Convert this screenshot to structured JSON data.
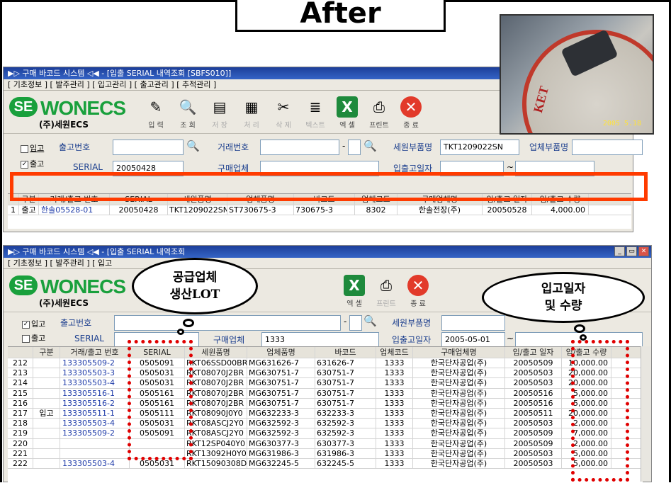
{
  "after_label": "After",
  "photo": {
    "ket_text": "KET",
    "timestamp": "2005 5.18"
  },
  "win1": {
    "title": "▶▷ 구매 바코드 시스템 ◁◀ - [입출 SERIAL 내역조회 [SBFS010]]",
    "menu": "[ 기초정보 ]  [ 발주관리 ]  [ 입고관리 ]  [ 출고관리 ]  [ 추적관리 ]",
    "logo": {
      "se": "SE",
      "name": "WONECS",
      "sub": "(주)세원ECS"
    },
    "toolbar": [
      {
        "icon": "eraser-icon",
        "glyph": "✎",
        "label": "입 력",
        "enabled": true
      },
      {
        "icon": "magnifier-icon",
        "glyph": "🔍",
        "label": "조 회",
        "enabled": true
      },
      {
        "icon": "floppy-icon",
        "glyph": "▤",
        "label": "저 장",
        "enabled": false
      },
      {
        "icon": "process-icon",
        "glyph": "▦",
        "label": "처 리",
        "enabled": false
      },
      {
        "icon": "delete-icon",
        "glyph": "✂",
        "label": "삭 제",
        "enabled": false
      },
      {
        "icon": "text-icon",
        "glyph": "≣",
        "label": "텍스트",
        "enabled": false
      },
      {
        "icon": "excel-icon",
        "glyph": "X",
        "label": "엑 셀",
        "enabled": true
      },
      {
        "icon": "printer-icon",
        "glyph": "⎙",
        "label": "프린트",
        "enabled": true
      },
      {
        "icon": "exit-icon",
        "glyph": "✕",
        "label": "종 료",
        "enabled": true
      }
    ],
    "search": {
      "opt_in": "입고",
      "opt_out": "출고",
      "lbl_ship_no": "출고번호",
      "lbl_trade_no": "거래번호",
      "lbl_sewon_part": "세원부품명",
      "lbl_vendor_part": "업체부품명",
      "lbl_serial": "SERIAL",
      "serial_val": "20050428",
      "lbl_buyer": "구매업체",
      "lbl_date": "입출고일자",
      "sewon_part_val": "TKT1209022SN",
      "range_sep": "~",
      "dash": "-"
    },
    "headers": [
      "구분",
      "거래/출고 번호",
      "SERIAL",
      "세원품명",
      "업체품명",
      "바코드",
      "업체코드",
      "구매업체명",
      "입/출고 일자",
      "입/출고 수량"
    ],
    "rows": [
      [
        "1",
        "출고",
        "한솔05528-01",
        "20050428",
        "TKT1209022SN",
        "ST730675-3",
        "730675-3",
        "8302",
        "한솔전장(주)",
        "20050528",
        "4,000.00"
      ]
    ]
  },
  "win2": {
    "title": "▶▷ 구매 바코드 시스템 ◁◀ - [입출 SERIAL 내역조회",
    "menu": "[ 기초정보 ]  [ 발주관리 ]  [ 입고",
    "logo": {
      "se": "SE",
      "name": "WONECS",
      "sub": "(주)세원ECS"
    },
    "toolbar": [
      {
        "icon": "excel-icon",
        "glyph": "X",
        "label": "엑 셀",
        "enabled": true
      },
      {
        "icon": "printer-icon",
        "glyph": "⎙",
        "label": "프린트",
        "enabled": false
      },
      {
        "icon": "exit-icon",
        "glyph": "✕",
        "label": "종 료",
        "enabled": true
      }
    ],
    "search": {
      "opt_in": "입고",
      "opt_out": "출고",
      "lbl_ship_no": "출고번호",
      "lbl_serial": "SERIAL",
      "lbl_buyer": "구매업체",
      "buyer_val": "1333",
      "lbl_sewon_part": "세원부품명",
      "lbl_date": "입출고일자",
      "date_val": "2005-05-01",
      "range_sep": "~",
      "dash": "-"
    },
    "headers": [
      "구분",
      "거래/출고 번호",
      "SERIAL",
      "세원품명",
      "업체품명",
      "바코드",
      "업체코드",
      "구매업체명",
      "입/출고 일자",
      "입/출고 수량"
    ],
    "category": "입고",
    "rows": [
      [
        "212",
        "133305509-2",
        "0505091",
        "RKT06SSD00BR",
        "MG631626-7",
        "631626-7",
        "1333",
        "한국단자공업(주)",
        "20050509",
        "10,000.00"
      ],
      [
        "213",
        "133305503-3",
        "0505031",
        "RKT08070J2BR",
        "MG630751-7",
        "630751-7",
        "1333",
        "한국단자공업(주)",
        "20050503",
        "20,000.00"
      ],
      [
        "214",
        "133305503-4",
        "0505031",
        "RKT08070J2BR",
        "MG630751-7",
        "630751-7",
        "1333",
        "한국단자공업(주)",
        "20050503",
        "20,000.00"
      ],
      [
        "215",
        "133305516-1",
        "0505161",
        "RKT08070J2BR",
        "MG630751-7",
        "630751-7",
        "1333",
        "한국단자공업(주)",
        "20050516",
        "5,000.00"
      ],
      [
        "216",
        "133305516-2",
        "0505161",
        "RKT08070J2BR",
        "MG630751-7",
        "630751-7",
        "1333",
        "한국단자공업(주)",
        "20050516",
        "5,000.00"
      ],
      [
        "217",
        "133305511-1",
        "0505111",
        "RKT08090J0Y0",
        "MG632233-3",
        "632233-3",
        "1333",
        "한국단자공업(주)",
        "20050511",
        "20,000.00"
      ],
      [
        "218",
        "133305503-4",
        "0505031",
        "RKT08ASCJ2Y0",
        "MG632592-3",
        "632592-3",
        "1333",
        "한국단자공업(주)",
        "20050503",
        "2,000.00"
      ],
      [
        "219",
        "133305509-2",
        "0505091",
        "RKT08ASCJ2Y0",
        "MG632592-3",
        "632592-3",
        "1333",
        "한국단자공업(주)",
        "20050509",
        "7,000.00"
      ],
      [
        "220",
        "",
        "",
        "RKT12SP040Y0",
        "MG630377-3",
        "630377-3",
        "1333",
        "한국단자공업(주)",
        "20050509",
        "2,000.00"
      ],
      [
        "221",
        "",
        "",
        "RKT13092H0Y0",
        "MG631986-3",
        "631986-3",
        "1333",
        "한국단자공업(주)",
        "20050503",
        "5,000.00"
      ],
      [
        "222",
        "133305503-4",
        "0505031",
        "RKT15090308D",
        "MG632245-5",
        "632245-5",
        "1333",
        "한국단자공업(주)",
        "20050503",
        "5,000.00"
      ]
    ]
  },
  "callouts": {
    "left_line1": "공급업체",
    "left_line2": "생산LOT",
    "right_line1": "입고일자",
    "right_line2": "및 수량"
  }
}
